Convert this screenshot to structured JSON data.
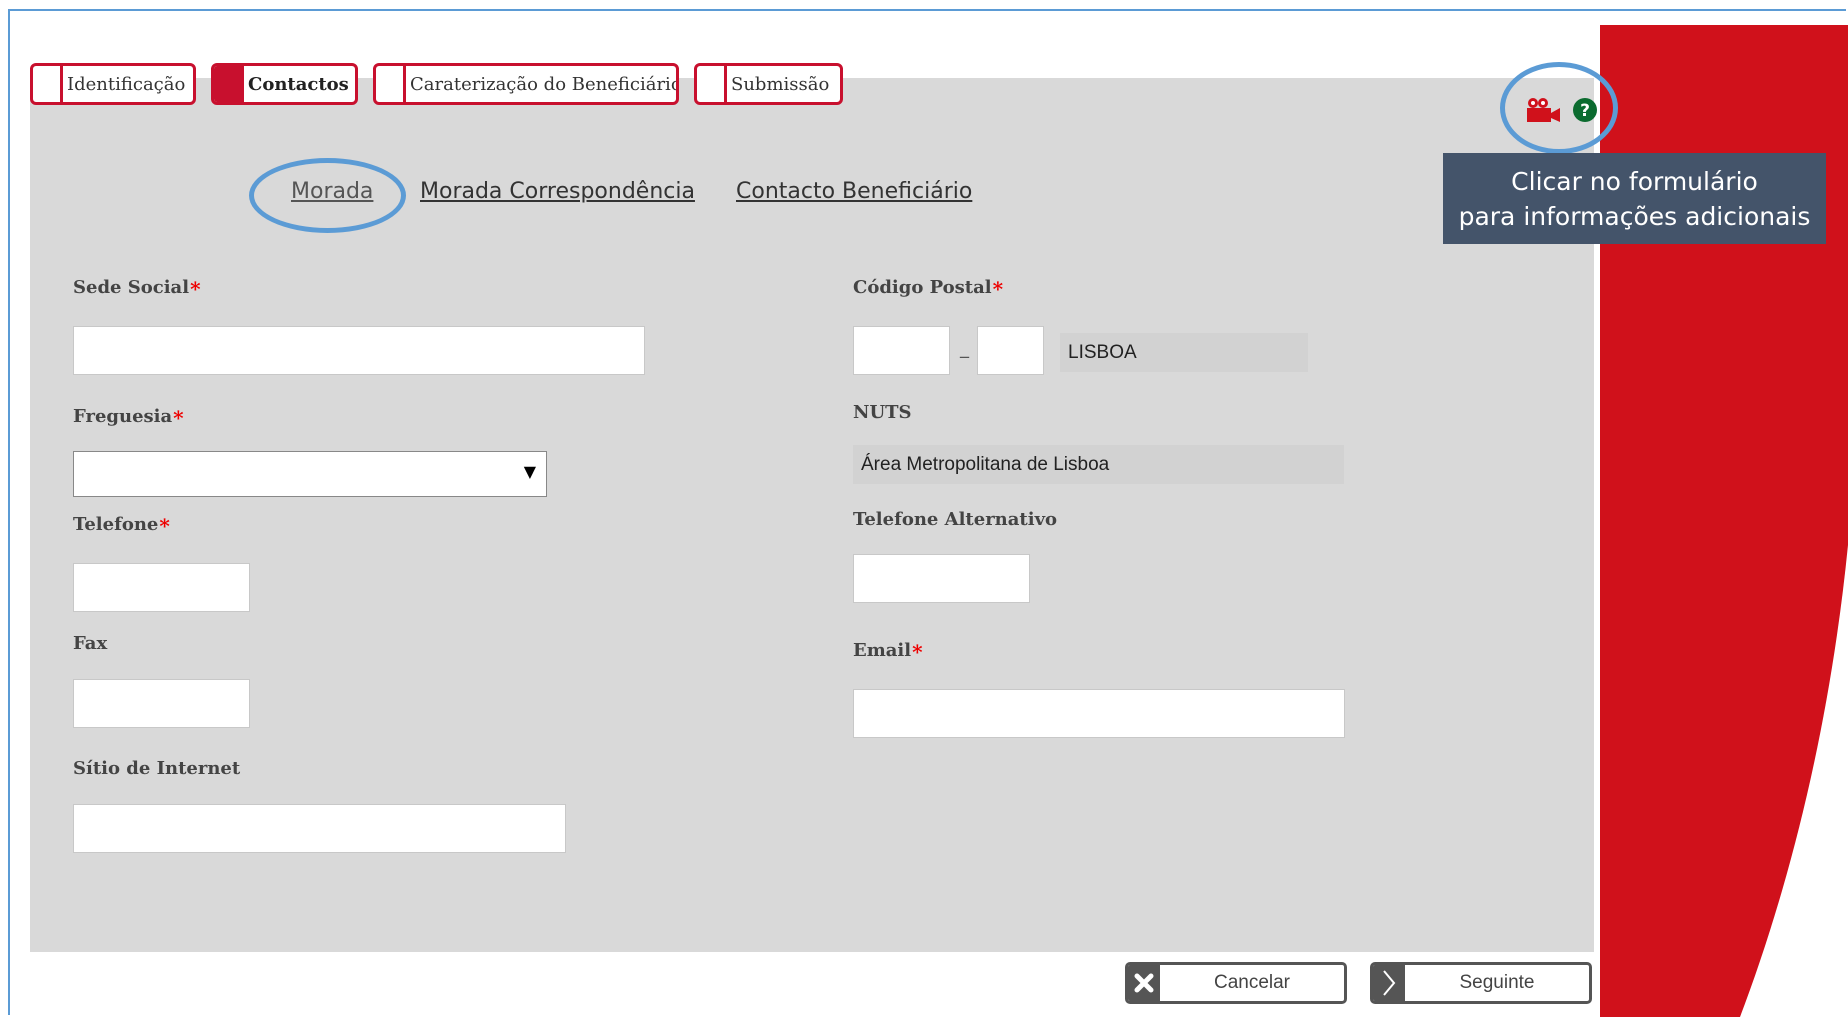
{
  "tabs": [
    {
      "label": "Identificação",
      "active": false
    },
    {
      "label": "Contactos",
      "active": true
    },
    {
      "label": "Caraterização do Beneficiário",
      "active": false
    },
    {
      "label": "Submissão",
      "active": false
    }
  ],
  "subtabs": [
    {
      "label": "Morada",
      "active": true
    },
    {
      "label": "Morada Correspondência",
      "active": false
    },
    {
      "label": "Contacto Beneficiário",
      "active": false
    }
  ],
  "icons": {
    "video": "video-camera-icon",
    "help": "help-icon"
  },
  "tooltip": {
    "line1": "Clicar no formulário",
    "line2": "para informações  adicionais"
  },
  "form": {
    "sede_social": {
      "label": "Sede Social",
      "value": ""
    },
    "freguesia": {
      "label": "Freguesia",
      "selected": ""
    },
    "telefone": {
      "label": "Telefone",
      "value": ""
    },
    "fax": {
      "label": "Fax",
      "value": ""
    },
    "sitio": {
      "label": "Sítio de Internet",
      "value": ""
    },
    "codigo_postal": {
      "label": "Código Postal",
      "part1": "",
      "separator": "_",
      "part2": "",
      "localidade": "LISBOA"
    },
    "nuts": {
      "label": "NUTS",
      "value": "Área Metropolitana de Lisboa"
    },
    "telefone_alt": {
      "label": "Telefone Alternativo",
      "value": ""
    },
    "email": {
      "label": "Email",
      "value": ""
    },
    "required_mark": "*"
  },
  "buttons": {
    "cancel": "Cancelar",
    "next": "Seguinte"
  },
  "colors": {
    "brand_red": "#c8102e",
    "panel_gray": "#d9d9d9",
    "highlight_blue": "#5b9bd5",
    "tooltip_bg": "#44546a"
  }
}
